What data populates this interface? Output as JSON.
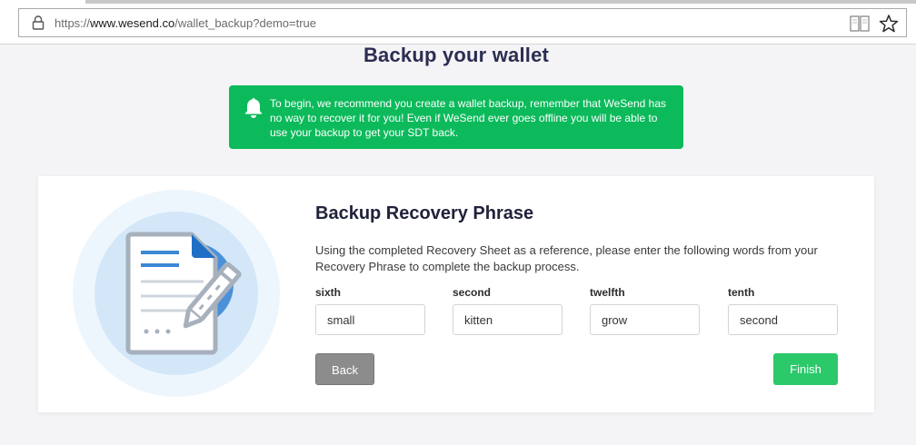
{
  "browser": {
    "url_prefix": "https://",
    "url_domain": "www.wesend.co",
    "url_path": "/wallet_backup?demo=true"
  },
  "page": {
    "title": "Backup your wallet"
  },
  "notice": {
    "text": "To begin, we recommend you create a wallet backup, remember that WeSend has no way to recover it for you! Even if WeSend ever goes offline you will be able to use your backup to get your SDT back.",
    "background": "#0cba5b"
  },
  "card": {
    "heading": "Backup Recovery Phrase",
    "description": "Using the completed Recovery Sheet as a reference, please enter the following words from your Recovery Phrase to complete the backup process.",
    "words": [
      {
        "label": "sixth",
        "value": "small"
      },
      {
        "label": "second",
        "value": "kitten"
      },
      {
        "label": "twelfth",
        "value": "grow"
      },
      {
        "label": "tenth",
        "value": "second"
      }
    ],
    "back_label": "Back",
    "finish_label": "Finish"
  },
  "colors": {
    "title": "#2b2d52",
    "finish_button": "#2bc96a",
    "back_button": "#8c8c8c",
    "illustration_blue": "#3b87d6"
  },
  "icons": {
    "lock": "lock-icon",
    "reader": "reader-view-icon",
    "star": "star-icon",
    "bell": "bell-icon",
    "document": "document-pencil-illustration"
  }
}
